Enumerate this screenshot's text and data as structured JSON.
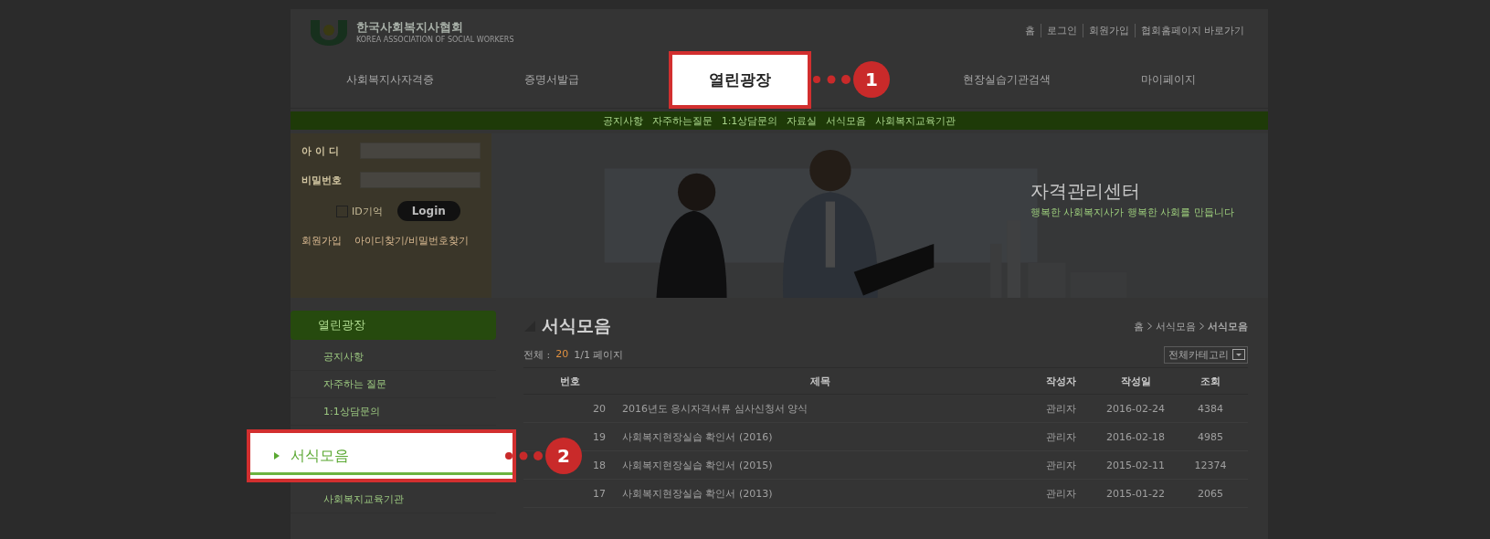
{
  "header": {
    "logo_title": "한국사회복지사협회",
    "logo_subtitle": "KOREA ASSOCIATION OF SOCIAL WORKERS",
    "links": [
      "홈",
      "로그인",
      "회원가입",
      "협회홈페이지 바로가기"
    ]
  },
  "nav": [
    {
      "label": "사회복지사자격증",
      "selected": false
    },
    {
      "label": "증명서발급",
      "selected": false
    },
    {
      "label": "열린광장",
      "selected": true,
      "callout": "1"
    },
    {
      "label": "현장실습기관검색",
      "selected": false
    },
    {
      "label": "마이페이지",
      "selected": false
    }
  ],
  "subnav": [
    "공지사항",
    "자주하는질문",
    "1:1상담문의",
    "자료실",
    "서식모음",
    "사회복지교육기관"
  ],
  "login": {
    "id_label": "아 이 디",
    "password_label": "비밀번호",
    "remember": {
      "label": "ID기억",
      "checked": false
    },
    "button": "Login",
    "links": [
      "회원가입",
      "아이디찾기/비밀번호찾기"
    ]
  },
  "banner": {
    "kind": "picture",
    "title": "자격관리센터",
    "subtitle": "행복한 사회복지사가 행복한 사회를 만듭니다"
  },
  "sidebar": {
    "title": "열린광장",
    "items": [
      {
        "label": "공지사항",
        "selected": false
      },
      {
        "label": "자주하는 질문",
        "selected": false
      },
      {
        "label": "1:1상담문의",
        "selected": false
      },
      {
        "label": "서식모음",
        "selected": true,
        "callout": "2"
      },
      {
        "label": "사회복지교육기관",
        "selected": false
      }
    ]
  },
  "content": {
    "title": "서식모음",
    "breadcrumb": [
      "홈",
      "서식모음",
      "서식모음"
    ],
    "total_label": "전체 :",
    "total": "20",
    "page_info": "1/1 페이지",
    "category": "전체카테고리"
  },
  "table": {
    "columns": [
      "번호",
      "제목",
      "작성자",
      "작성일",
      "조회"
    ],
    "rows": [
      [
        "20",
        "2016년도 응시자격서류 심사신청서 양식",
        "관리자",
        "2016-02-24",
        "4384"
      ],
      [
        "19",
        "사회복지현장실습 확인서 (2016)",
        "관리자",
        "2016-02-18",
        "4985"
      ],
      [
        "18",
        "사회복지현장실습 확인서 (2015)",
        "관리자",
        "2015-02-11",
        "12374"
      ],
      [
        "17",
        "사회복지현장실습 확인서 (2013)",
        "관리자",
        "2015-01-22",
        "2065"
      ]
    ]
  }
}
